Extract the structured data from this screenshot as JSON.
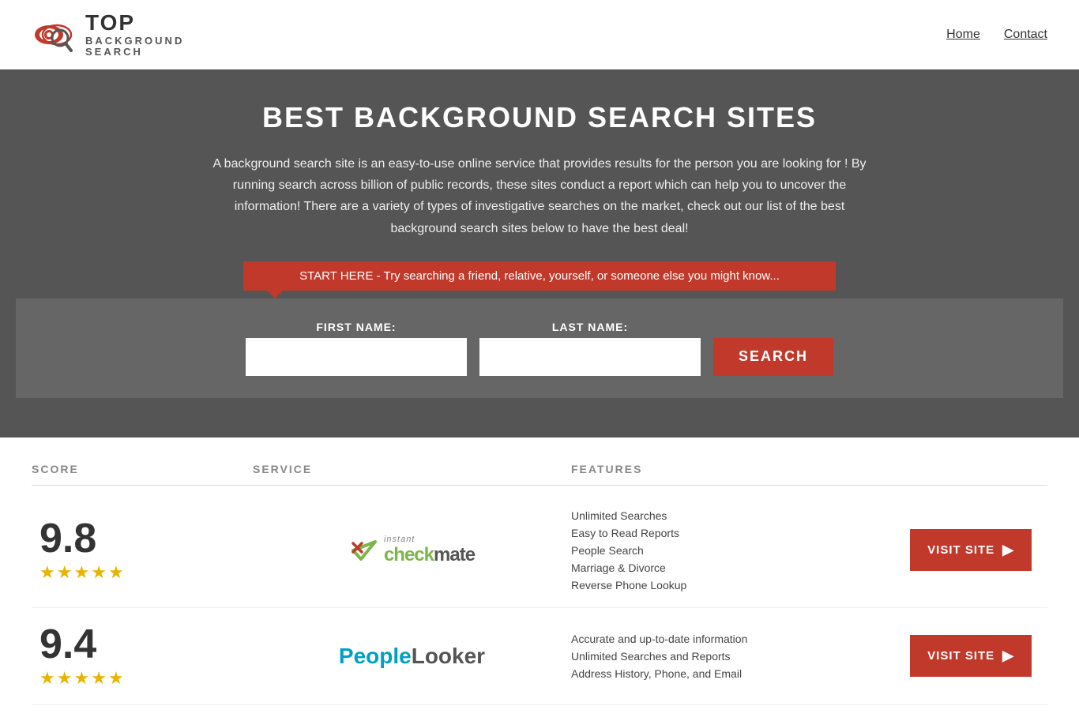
{
  "header": {
    "logo_top": "TOP",
    "logo_bottom": "BACKGROUND\nSEARCH",
    "nav": [
      {
        "label": "Home",
        "href": "#"
      },
      {
        "label": "Contact",
        "href": "#"
      }
    ]
  },
  "hero": {
    "title": "BEST BACKGROUND SEARCH SITES",
    "description": "A background search site is an easy-to-use online service that provides results  for the person you are looking for ! By  running  search across billion of public records, these sites conduct  a report which can help you to uncover the information! There are a variety of types of investigative searches on the market, check out our  list of the best background search sites below to have the best deal!",
    "search_banner": "START HERE - Try searching a friend, relative, yourself, or someone else you might know...",
    "first_name_label": "FIRST NAME:",
    "last_name_label": "LAST NAME:",
    "search_button": "SEARCH"
  },
  "table": {
    "headers": {
      "score": "SCORE",
      "service": "SERVICE",
      "features": "FEATURES",
      "action": ""
    },
    "rows": [
      {
        "score": "9.8",
        "stars": 4.5,
        "service_name": "Instant Checkmate",
        "service_type": "checkmate",
        "features": [
          "Unlimited Searches",
          "Easy to Read Reports",
          "People Search",
          "Marriage & Divorce",
          "Reverse Phone Lookup"
        ],
        "visit_label": "VISIT SITE"
      },
      {
        "score": "9.4",
        "stars": 4.5,
        "service_name": "PeopleLooker",
        "service_type": "peoplelooker",
        "features": [
          "Accurate and up-to-date information",
          "Unlimited Searches and Reports",
          "Address History, Phone, and Email"
        ],
        "visit_label": "VISIT SITE"
      }
    ]
  }
}
